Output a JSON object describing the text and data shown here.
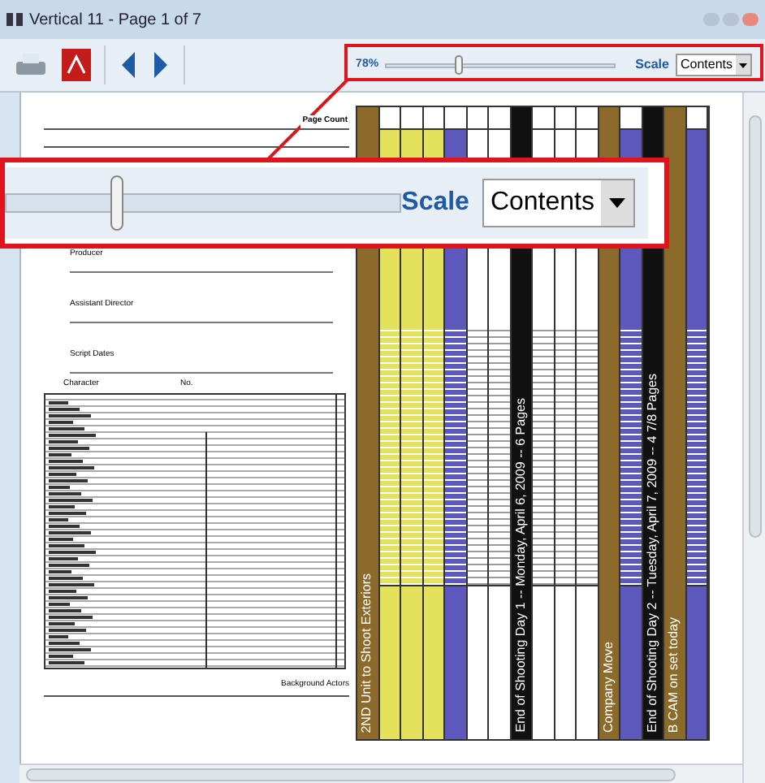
{
  "window": {
    "title": "Vertical 11 - Page 1 of 7"
  },
  "toolbar": {
    "zoom": "78%",
    "zoom_slider": {
      "level": 0.3
    },
    "scale_label": "Scale",
    "scale_value": "Contents"
  },
  "callout": {
    "scale_label": "Scale",
    "scale_value": "Contents"
  },
  "page": {
    "page_count_label": "Page Count",
    "fields": [
      {
        "label": "Producer"
      },
      {
        "label": "Assistant Director"
      },
      {
        "label": "Script Dates"
      }
    ],
    "character_header": "Character",
    "number_header": "No.",
    "background_label": "Background Actors",
    "strips": [
      {
        "kind": "banner",
        "color": "#8c6a2c",
        "text": "2ND Unit to Shoot Exteriors"
      },
      {
        "kind": "scene",
        "color": "#e4e25c"
      },
      {
        "kind": "scene",
        "color": "#e4e25c"
      },
      {
        "kind": "scene",
        "color": "#e4e25c"
      },
      {
        "kind": "scene",
        "color": "#5c58bc"
      },
      {
        "kind": "scene",
        "color": "#ffffff"
      },
      {
        "kind": "scene",
        "color": "#ffffff"
      },
      {
        "kind": "banner",
        "color": "#111111",
        "text": "End of Shooting Day 1 -- Monday, April 6, 2009 -- 6 Pages"
      },
      {
        "kind": "scene",
        "color": "#ffffff"
      },
      {
        "kind": "scene",
        "color": "#ffffff"
      },
      {
        "kind": "scene",
        "color": "#ffffff"
      },
      {
        "kind": "banner",
        "color": "#8c6a2c",
        "text": "Company Move"
      },
      {
        "kind": "scene",
        "color": "#5c58bc"
      },
      {
        "kind": "banner",
        "color": "#111111",
        "text": "End of Shooting Day 2 -- Tuesday, April 7, 2009 -- 4 7/8 Pages"
      },
      {
        "kind": "banner",
        "color": "#8c6a2c",
        "text": "B CAM on set today"
      },
      {
        "kind": "scene",
        "color": "#5c58bc"
      }
    ]
  }
}
